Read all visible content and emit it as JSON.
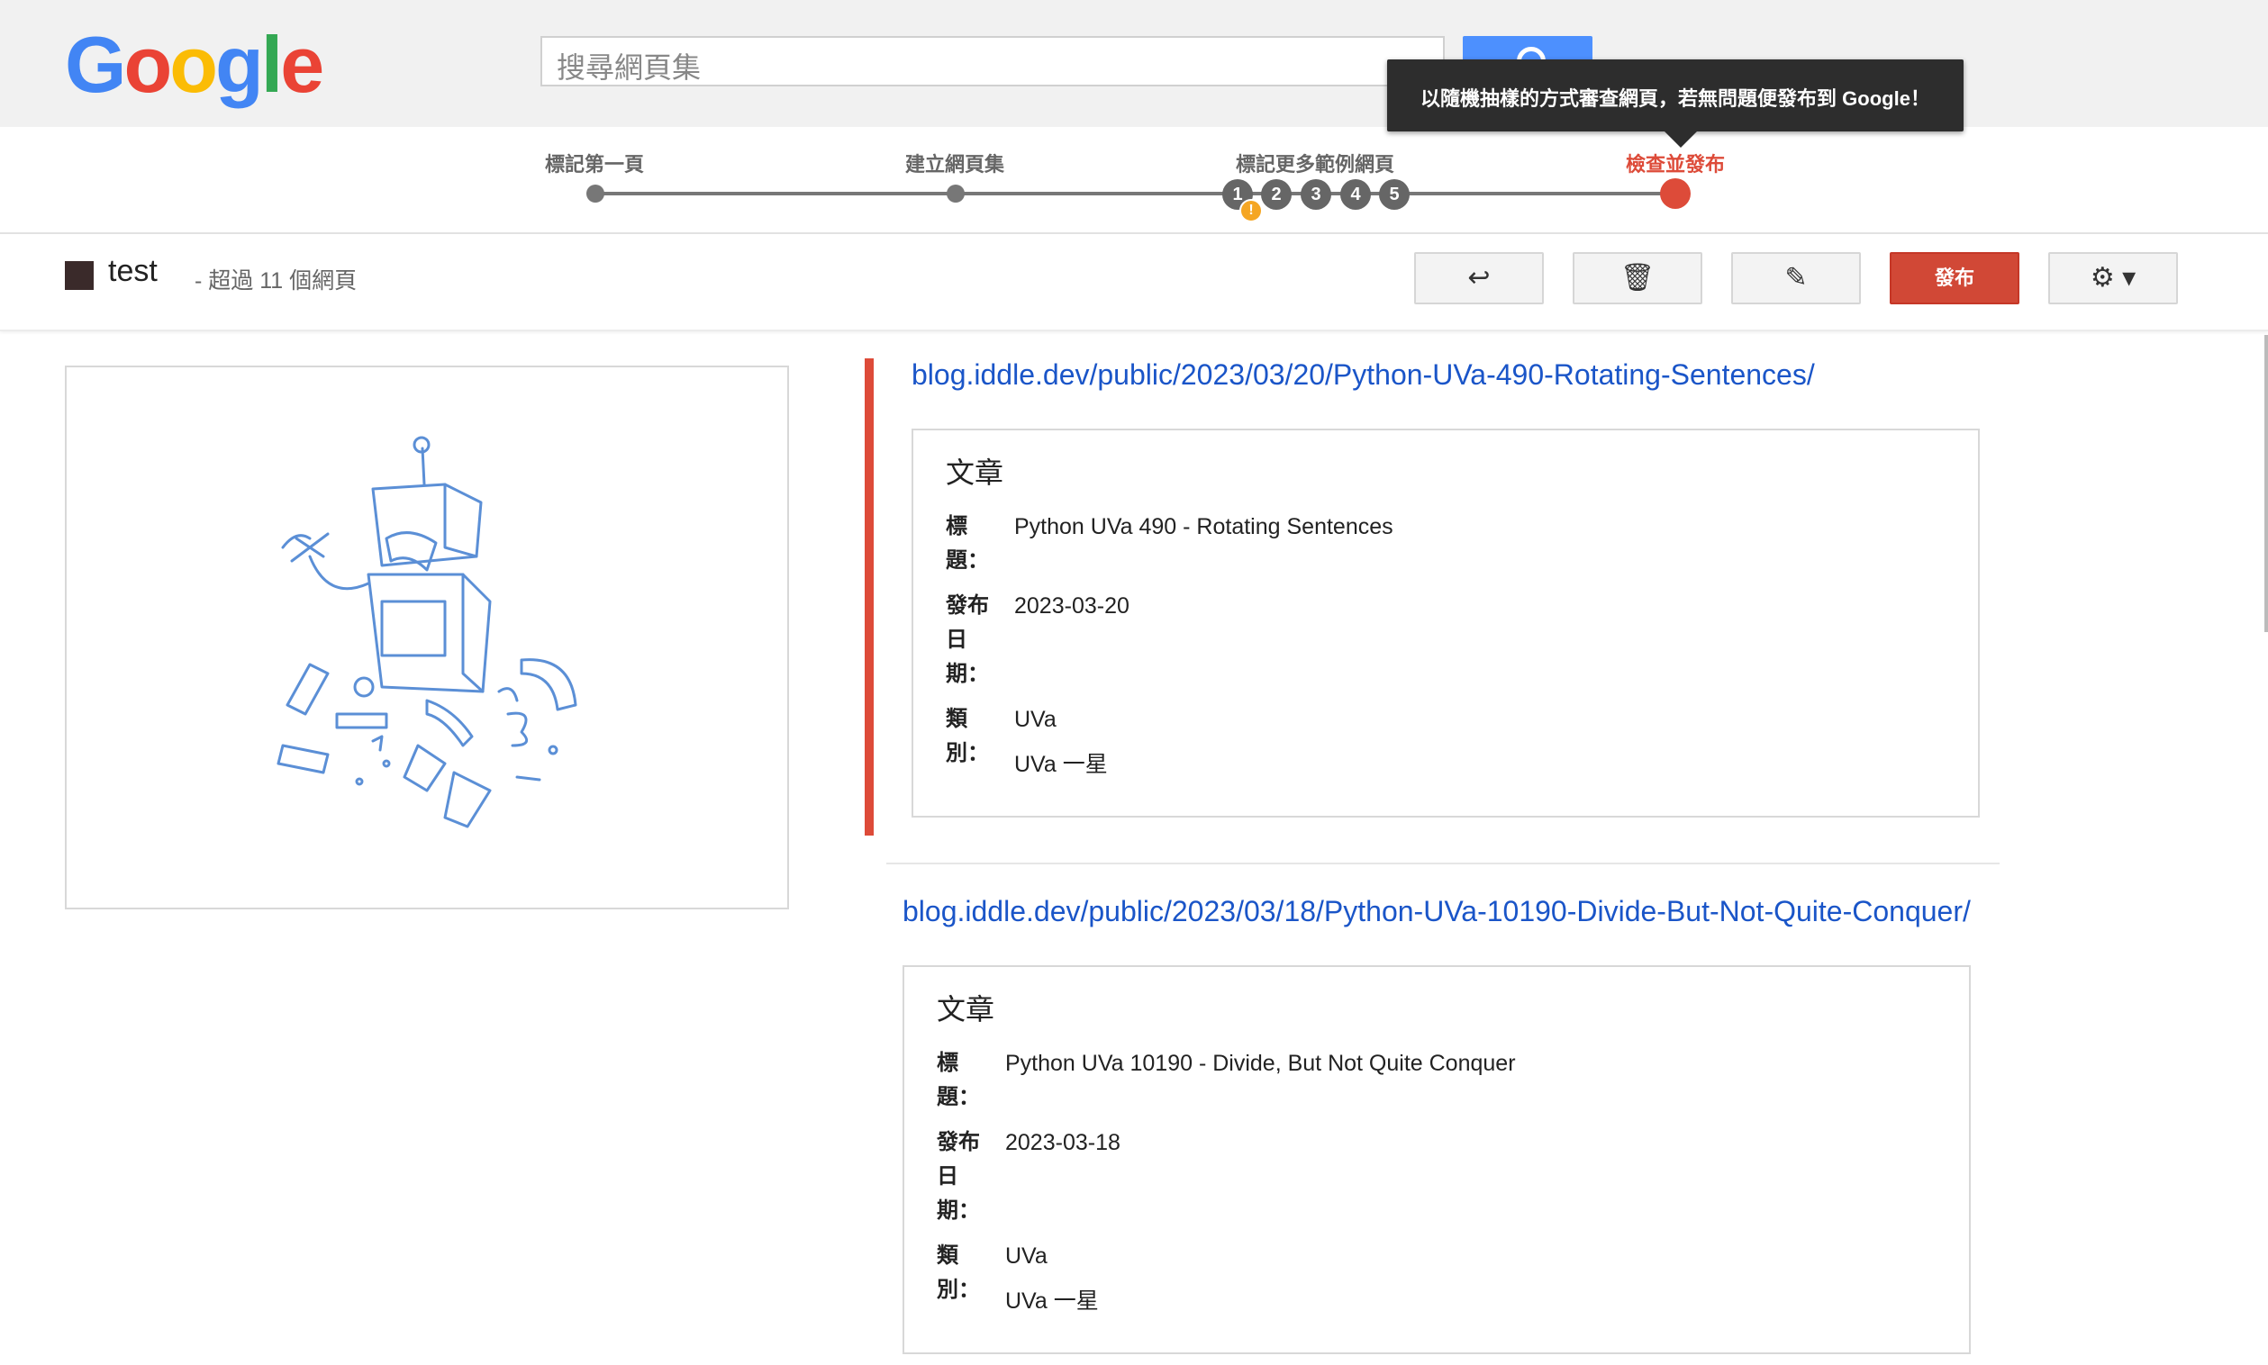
{
  "logo": {
    "g1": "G",
    "o1": "o",
    "o2": "o",
    "g2": "g",
    "l": "l",
    "e": "e"
  },
  "search": {
    "placeholder": "搜尋網頁集"
  },
  "tooltip": {
    "text": "以隨機抽樣的方式審查網頁，若無問題便發布到 Google！"
  },
  "steps": {
    "labels": [
      "標記第一頁",
      "建立網頁集",
      "標記更多範例網頁",
      "檢查並發布"
    ],
    "numbers": [
      "1",
      "2",
      "3",
      "4",
      "5"
    ],
    "warning": "!"
  },
  "toolbar": {
    "title": "test",
    "subtitle": "- 超過 11 個網頁",
    "back_icon": "↩",
    "delete_icon": "🗑",
    "edit_icon": "✎",
    "publish_label": "發布",
    "settings_icon": "⚙ ▾"
  },
  "results": [
    {
      "url": "blog.iddle.dev/public/2023/03/20/Python-UVa-490-Rotating-Sentences/",
      "card_title": "文章",
      "title_label": "標題：",
      "title": "Python UVa 490 - Rotating Sentences",
      "date_label": "發布日期：",
      "date": "2023-03-20",
      "category_label": "類別：",
      "categories": [
        "UVa",
        "UVa 一星"
      ]
    },
    {
      "url": "blog.iddle.dev/public/2023/03/18/Python-UVa-10190-Divide-But-Not-Quite-Conquer/",
      "card_title": "文章",
      "title_label": "標題：",
      "title": "Python UVa 10190 - Divide, But Not Quite Conquer",
      "date_label": "發布日期：",
      "date": "2023-03-18",
      "category_label": "類別：",
      "categories": [
        "UVa",
        "UVa 一星"
      ]
    }
  ],
  "colors": {
    "accent": "#dd4b39",
    "link": "#1a55c8",
    "primary": "#4d90fe"
  }
}
